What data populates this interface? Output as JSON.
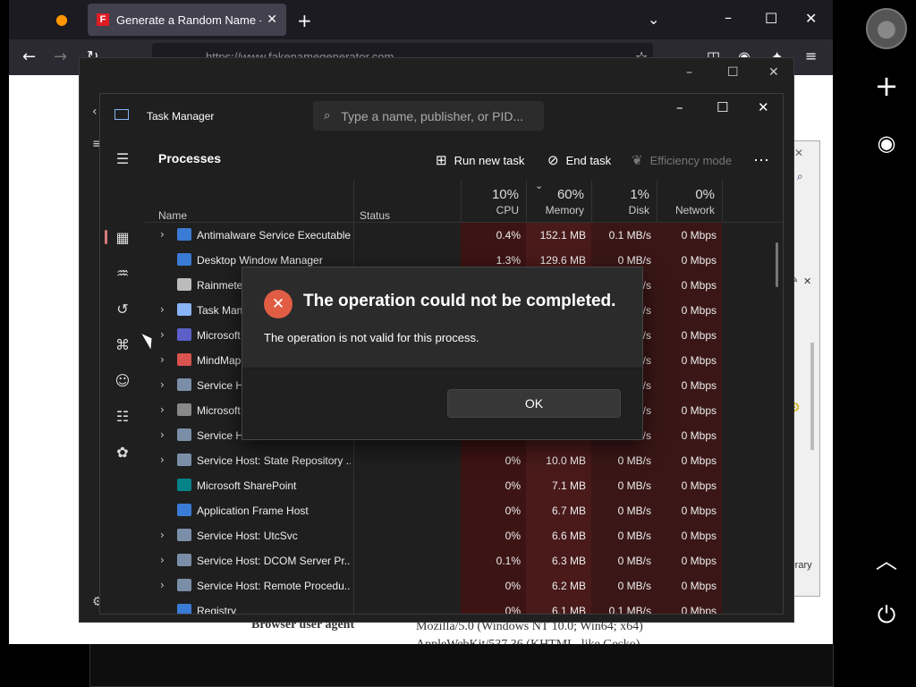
{
  "browser": {
    "tab_title": "Generate a Random Name - Fake Name Generator",
    "tab_favicon": "F",
    "url": "https://www.fakenamegenerator.com",
    "page": {
      "ua_label": "Browser user agent",
      "ua_value": "Mozilla/5.0 (Windows NT 10.0; Win64; x64) AppleWebKit/537.36 (KHTML, like Gecko)"
    }
  },
  "side_panel": {
    "library_label": "Library"
  },
  "task_manager": {
    "title": "Task Manager",
    "search_placeholder": "Type a name, publisher, or PID...",
    "section": "Processes",
    "toolbar": {
      "run_new_task": "Run new task",
      "end_task": "End task",
      "efficiency_mode": "Efficiency mode",
      "more": "⋯"
    },
    "columns": {
      "name": "Name",
      "status": "Status",
      "cpu_pct": "10%",
      "cpu": "CPU",
      "memory_pct": "60%",
      "memory": "Memory",
      "disk_pct": "1%",
      "disk": "Disk",
      "network_pct": "0%",
      "network": "Network"
    },
    "rows": [
      {
        "name": "Antimalware Service Executable",
        "expand": true,
        "cpu": "0.4%",
        "mem": "152.1 MB",
        "disk": "0.1 MB/s",
        "net": "0 Mbps",
        "icon": "#3a7bd5"
      },
      {
        "name": "Desktop Window Manager",
        "expand": false,
        "cpu": "1.3%",
        "mem": "129.6 MB",
        "disk": "0 MB/s",
        "net": "0 Mbps",
        "icon": "#3a7bd5"
      },
      {
        "name": "Rainmeter",
        "expand": false,
        "cpu": "",
        "mem": "",
        "disk": "/s",
        "net": "0 Mbps",
        "icon": "#bbbbbb"
      },
      {
        "name": "Task Manager",
        "expand": true,
        "cpu": "",
        "mem": "",
        "disk": "/s",
        "net": "0 Mbps",
        "icon": "#8ab4f8"
      },
      {
        "name": "Microsoft Teams",
        "expand": true,
        "cpu": "",
        "mem": "",
        "disk": "/s",
        "net": "0 Mbps",
        "icon": "#5b5fc7"
      },
      {
        "name": "MindMapper",
        "expand": true,
        "cpu": "",
        "mem": "",
        "disk": "/s",
        "net": "0 Mbps",
        "icon": "#d9534f"
      },
      {
        "name": "Service Host",
        "expand": true,
        "cpu": "",
        "mem": "",
        "disk": "/s",
        "net": "0 Mbps",
        "icon": "#7a8ea8"
      },
      {
        "name": "Microsoft",
        "expand": true,
        "cpu": "",
        "mem": "",
        "disk": "/s",
        "net": "0 Mbps",
        "icon": "#888888"
      },
      {
        "name": "Service Host",
        "expand": true,
        "cpu": "",
        "mem": "",
        "disk": "/s",
        "net": "0 Mbps",
        "icon": "#7a8ea8"
      },
      {
        "name": "Service Host: State Repository ...",
        "expand": true,
        "cpu": "0%",
        "mem": "10.0 MB",
        "disk": "0 MB/s",
        "net": "0 Mbps",
        "icon": "#7a8ea8"
      },
      {
        "name": "Microsoft SharePoint",
        "expand": false,
        "cpu": "0%",
        "mem": "7.1 MB",
        "disk": "0 MB/s",
        "net": "0 Mbps",
        "icon": "#038387"
      },
      {
        "name": "Application Frame Host",
        "expand": false,
        "cpu": "0%",
        "mem": "6.7 MB",
        "disk": "0 MB/s",
        "net": "0 Mbps",
        "icon": "#3a7bd5"
      },
      {
        "name": "Service Host: UtcSvc",
        "expand": true,
        "cpu": "0%",
        "mem": "6.6 MB",
        "disk": "0 MB/s",
        "net": "0 Mbps",
        "icon": "#7a8ea8"
      },
      {
        "name": "Service Host: DCOM Server Pr...",
        "expand": true,
        "cpu": "0.1%",
        "mem": "6.3 MB",
        "disk": "0 MB/s",
        "net": "0 Mbps",
        "icon": "#7a8ea8"
      },
      {
        "name": "Service Host: Remote Procedu...",
        "expand": true,
        "cpu": "0%",
        "mem": "6.2 MB",
        "disk": "0 MB/s",
        "net": "0 Mbps",
        "icon": "#7a8ea8"
      },
      {
        "name": "Registry",
        "expand": false,
        "cpu": "0%",
        "mem": "6.1 MB",
        "disk": "0.1 MB/s",
        "net": "0 Mbps",
        "icon": "#3a7bd5"
      }
    ]
  },
  "dialog": {
    "title": "The operation could not be completed.",
    "message": "The operation is not valid for this process.",
    "ok": "OK",
    "error_glyph": "✕"
  },
  "colors": {
    "heat_strong": "#5c1b1b",
    "heat_medium": "#4a1818",
    "heat_light": "#3a1616",
    "error": "#e05d44"
  }
}
